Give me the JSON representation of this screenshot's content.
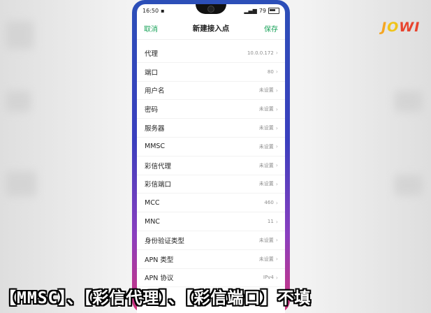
{
  "status_bar": {
    "time": "16:50",
    "battery_pct": "79"
  },
  "nav": {
    "cancel_label": "取消",
    "title": "新建接入点",
    "save_label": "保存"
  },
  "settings": [
    {
      "label": "代理",
      "value": "10.0.0.172"
    },
    {
      "label": "端口",
      "value": "80"
    },
    {
      "label": "用户名",
      "value": "未设置"
    },
    {
      "label": "密码",
      "value": "未设置"
    },
    {
      "label": "服务器",
      "value": "未设置"
    },
    {
      "label": "MMSC",
      "value": "未设置"
    },
    {
      "label": "彩信代理",
      "value": "未设置"
    },
    {
      "label": "彩信端口",
      "value": "未设置"
    },
    {
      "label": "MCC",
      "value": "460"
    },
    {
      "label": "MNC",
      "value": "11"
    },
    {
      "label": "身份验证类型",
      "value": "未设置"
    },
    {
      "label": "APN 类型",
      "value": "未设置"
    },
    {
      "label": "APN 协议",
      "value": "IPv4"
    }
  ],
  "caption": "【MMSC】、【彩信代理】、【彩信端口】不填",
  "logo": {
    "letters": [
      "J",
      "O",
      "W",
      "I"
    ],
    "colors": [
      "#f5a623",
      "#f0c419",
      "#e8442e",
      "#e8442e"
    ]
  },
  "colors": {
    "accent": "#1aa35a"
  }
}
